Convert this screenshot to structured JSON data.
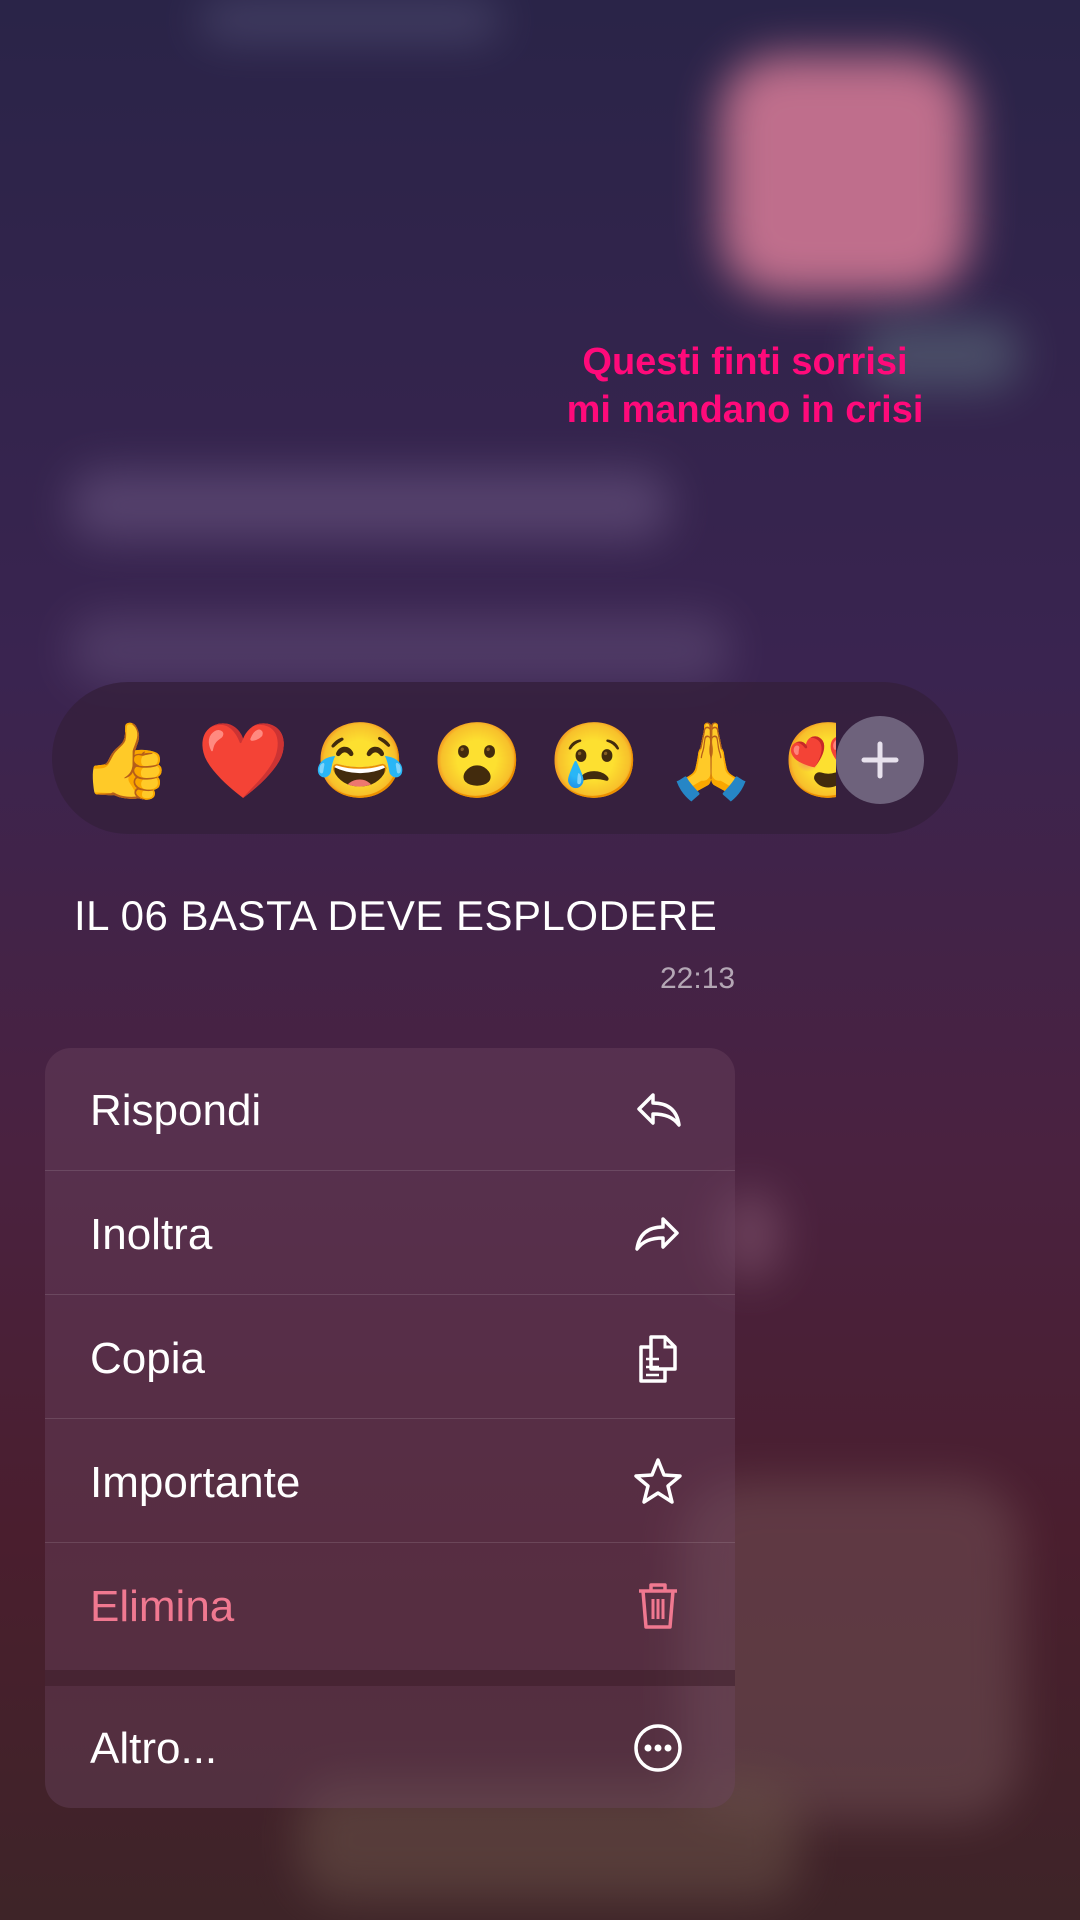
{
  "story": {
    "caption_lines": [
      "Questi finti sorrisi",
      "mi mandano in crisi"
    ]
  },
  "reactions": {
    "emojis": [
      "👍",
      "❤️",
      "😂",
      "😮",
      "😢",
      "🙏",
      "😍"
    ],
    "more_icon": "plus-icon"
  },
  "message": {
    "text": "IL 06 BASTA DEVE ESPLODERE",
    "time": "22:13"
  },
  "menu": {
    "items": [
      {
        "label": "Rispondi",
        "icon": "reply-icon"
      },
      {
        "label": "Inoltra",
        "icon": "forward-icon"
      },
      {
        "label": "Copia",
        "icon": "copy-icon"
      },
      {
        "label": "Importante",
        "icon": "star-icon"
      },
      {
        "label": "Elimina",
        "icon": "trash-icon"
      },
      {
        "label": "Altro...",
        "icon": "more-icon"
      }
    ]
  },
  "colors": {
    "caption": "#ff0a7a",
    "danger": "#f07890"
  }
}
